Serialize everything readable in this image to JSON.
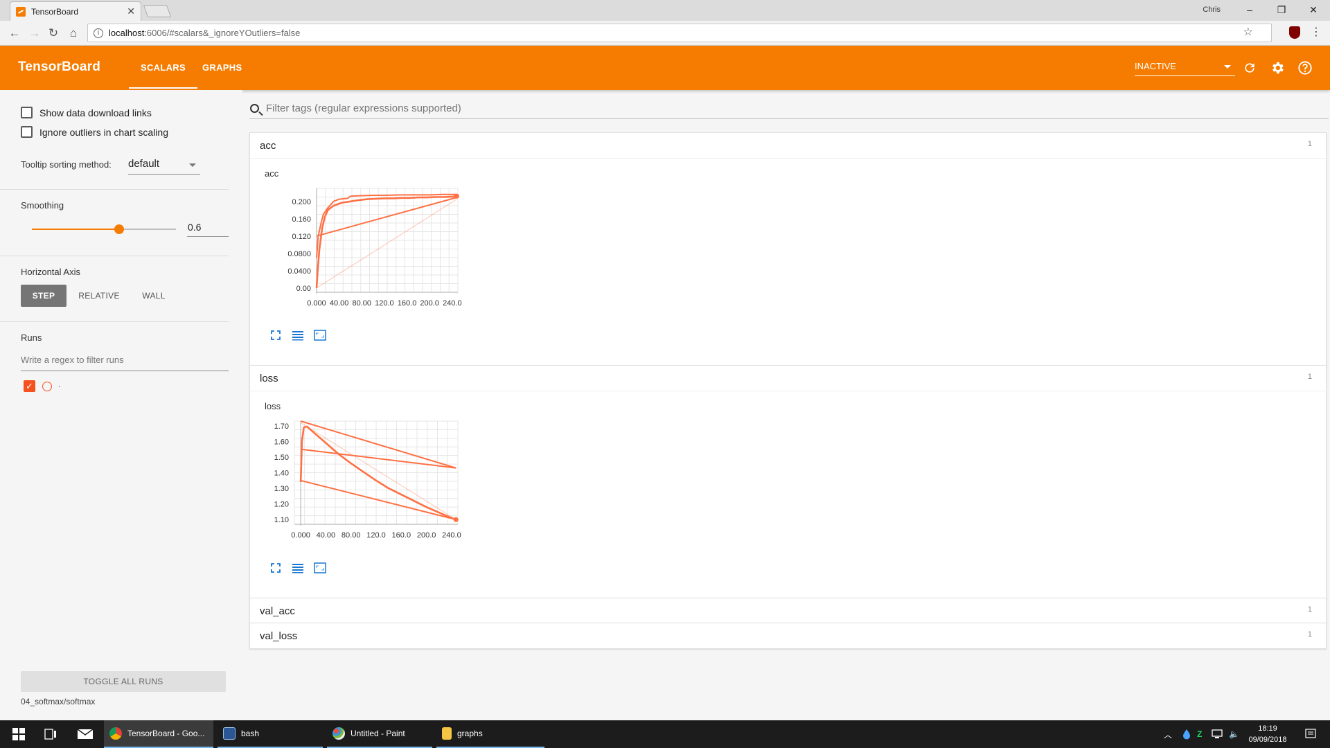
{
  "browser": {
    "tab_title": "TensorBoard",
    "tab_close": "✕",
    "profile_name": "Chris",
    "window_controls": {
      "minimize": "–",
      "restore": "❐",
      "close": "✕"
    },
    "url_host": "localhost",
    "url_rest": ":6006/#scalars&_ignoreYOutliers=false"
  },
  "header": {
    "title": "TensorBoard",
    "tabs": [
      {
        "label": "SCALARS",
        "active": true
      },
      {
        "label": "GRAPHS",
        "active": false
      }
    ],
    "status": "INACTIVE",
    "accent_color": "#f57c00"
  },
  "sidebar": {
    "show_download_links": "Show data download links",
    "ignore_outliers": "Ignore outliers in chart scaling",
    "tooltip_label": "Tooltip sorting method:",
    "tooltip_value": "default",
    "smoothing_label": "Smoothing",
    "smoothing_value": "0.6",
    "smoothing_fraction": 0.6,
    "horizontal_axis_label": "Horizontal Axis",
    "axis_options": [
      "STEP",
      "RELATIVE",
      "WALL"
    ],
    "axis_selected": "STEP",
    "runs_label": "Runs",
    "runs_filter_placeholder": "Write a regex to filter runs",
    "run_name": ".",
    "toggle_all_runs": "TOGGLE ALL RUNS",
    "logdir": "04_softmax/softmax"
  },
  "main": {
    "filter_placeholder": "Filter tags (regular expressions supported)",
    "categories": [
      {
        "name": "acc",
        "count": "1"
      },
      {
        "name": "loss",
        "count": "1"
      },
      {
        "name": "val_acc",
        "count": "1"
      },
      {
        "name": "val_loss",
        "count": "1"
      }
    ]
  },
  "chart_data": [
    {
      "type": "line",
      "title": "acc",
      "xlabel": "",
      "ylabel": "",
      "xlim": [
        0,
        250
      ],
      "ylim": [
        -0.01,
        0.23
      ],
      "x_ticks": [
        "0.000",
        "40.00",
        "80.00",
        "120.0",
        "160.0",
        "200.0",
        "240.0"
      ],
      "y_ticks": [
        "0.00",
        "0.0400",
        "0.0800",
        "0.120",
        "0.160",
        "0.200"
      ],
      "x_tick_values": [
        0,
        40,
        80,
        120,
        160,
        200,
        240
      ],
      "y_tick_values": [
        0,
        0.04,
        0.08,
        0.12,
        0.16,
        0.2
      ],
      "grid": true,
      "series": [
        {
          "role": "smoothed",
          "x": [
            0,
            2,
            5,
            10,
            15,
            20,
            30,
            45,
            60,
            75,
            90,
            105,
            120,
            135,
            150,
            165,
            180,
            195,
            210,
            225,
            240,
            248
          ],
          "y": [
            0.0,
            0.04,
            0.09,
            0.14,
            0.165,
            0.18,
            0.19,
            0.197,
            0.2,
            0.203,
            0.205,
            0.206,
            0.207,
            0.207,
            0.208,
            0.208,
            0.209,
            0.209,
            0.21,
            0.21,
            0.211,
            0.212
          ]
        },
        {
          "role": "smoothed-wrap",
          "x": [
            0,
            3,
            8,
            12,
            20,
            30,
            40,
            55,
            60,
            75,
            100,
            120,
            150,
            180,
            200,
            220,
            240,
            248
          ],
          "y": [
            0.07,
            0.12,
            0.15,
            0.17,
            0.185,
            0.2,
            0.205,
            0.207,
            0.212,
            0.213,
            0.214,
            0.214,
            0.215,
            0.215,
            0.215,
            0.216,
            0.216,
            0.216
          ]
        },
        {
          "role": "smoothed-wrap",
          "x": [
            0,
            248
          ],
          "y": [
            0.12,
            0.209
          ]
        },
        {
          "role": "raw",
          "x": [
            0,
            248
          ],
          "y": [
            0.0,
            0.205
          ]
        }
      ],
      "line_color": "#ff7043"
    },
    {
      "type": "line",
      "title": "loss",
      "xlabel": "",
      "ylabel": "",
      "xlim": [
        -10,
        250
      ],
      "ylim": [
        1.07,
        1.73
      ],
      "x_ticks": [
        "0.000",
        "40.00",
        "80.00",
        "120.0",
        "160.0",
        "200.0",
        "240.0"
      ],
      "y_ticks": [
        "1.10",
        "1.20",
        "1.30",
        "1.40",
        "1.50",
        "1.60",
        "1.70"
      ],
      "x_tick_values": [
        0,
        40,
        80,
        120,
        160,
        200,
        240
      ],
      "y_tick_values": [
        1.1,
        1.2,
        1.3,
        1.4,
        1.5,
        1.6,
        1.7
      ],
      "grid": true,
      "series": [
        {
          "role": "smoothed",
          "x": [
            0,
            2,
            5,
            10,
            20,
            40,
            60,
            80,
            100,
            120,
            140,
            160,
            180,
            200,
            220,
            240,
            247
          ],
          "y": [
            1.34,
            1.6,
            1.69,
            1.695,
            1.66,
            1.59,
            1.52,
            1.46,
            1.405,
            1.35,
            1.3,
            1.26,
            1.22,
            1.18,
            1.145,
            1.11,
            1.1
          ]
        },
        {
          "role": "smoothed-wrap",
          "x": [
            0,
            247
          ],
          "y": [
            1.73,
            1.43
          ]
        },
        {
          "role": "smoothed-wrap",
          "x": [
            0,
            247
          ],
          "y": [
            1.55,
            1.43
          ]
        },
        {
          "role": "smoothed-wrap",
          "x": [
            0,
            247
          ],
          "y": [
            1.35,
            1.1
          ]
        },
        {
          "role": "raw",
          "x": [
            0,
            247
          ],
          "y": [
            1.72,
            1.1
          ]
        }
      ],
      "line_color": "#ff7043"
    }
  ],
  "taskbar": {
    "items": [
      {
        "label": "TensorBoard - Goo...",
        "icon": "chrome-icon",
        "color": "#db4437"
      },
      {
        "label": "bash",
        "icon": "terminal-icon",
        "color": "#2b5797"
      },
      {
        "label": "Untitled - Paint",
        "icon": "paint-icon",
        "color": "#7dbb3f"
      },
      {
        "label": "graphs",
        "icon": "folder-icon",
        "color": "#f4c542"
      }
    ],
    "time": "18:19",
    "date": "09/09/2018"
  }
}
